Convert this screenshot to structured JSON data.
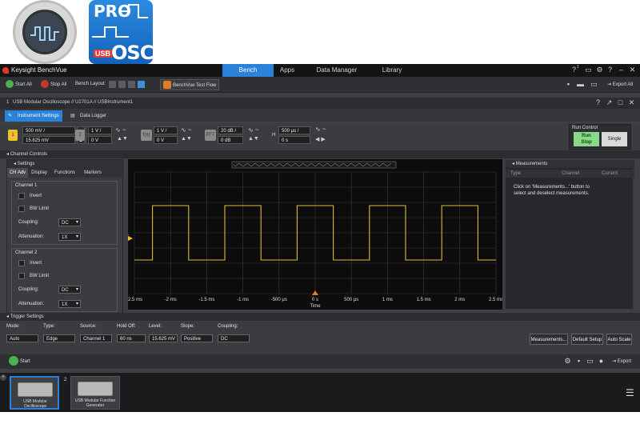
{
  "window": {
    "app_name": "Keysight BenchVue",
    "nav_tabs": [
      "Bench",
      "Apps",
      "Data Manager",
      "Library"
    ],
    "help_count": "1"
  },
  "logos": {
    "pro": "PRO",
    "usb": "USB",
    "osc": "OSC"
  },
  "toolbar": {
    "start_all": "Start All",
    "stop_all": "Stop All",
    "bench_layout": "Bench Layout:",
    "test_flow": "BenchVue Test Flow",
    "export_all": "Export All"
  },
  "instrument": {
    "index": "1",
    "path": "USB Modular Oscilloscope // U2701A // USBInstrument1",
    "tabs": [
      "Instrument Settings",
      "Data Logger"
    ]
  },
  "channels": [
    {
      "badge": "1",
      "scale": "500 mV /",
      "offset": "15.625 mV",
      "color": "#f2c02e"
    },
    {
      "badge": "2",
      "scale": "1 V /",
      "offset": "0 V",
      "color": "#8a8a8a"
    },
    {
      "badge": "f(x)",
      "scale": "1 V /",
      "offset": "0 V",
      "color": "#8a8a8a"
    },
    {
      "badge": "FFT",
      "scale": "20 dB /",
      "offset": "0 dB",
      "color": "#8a8a8a"
    }
  ],
  "horizontal": {
    "label": "H",
    "scale": "500 µs /",
    "position": "0 s"
  },
  "run_control": {
    "title": "Run Control",
    "run_stop": [
      "Run",
      "Stop"
    ],
    "single": "Single"
  },
  "channel_controls_label": "Channel Controls",
  "settings": {
    "title": "Settings",
    "tabs": [
      "CH Adv",
      "Display",
      "Functions",
      "Markers"
    ],
    "channel1": {
      "title": "Channel 1",
      "invert": "Invert",
      "bw_limit": "BW Limit",
      "coupling_label": "Coupling:",
      "coupling": "DC",
      "atten_label": "Attenuation:",
      "atten": "1X"
    },
    "channel2": {
      "title": "Channel 2",
      "invert": "Invert",
      "bw_limit": "BW Limit",
      "coupling_label": "Coupling:",
      "coupling": "DC",
      "atten_label": "Attenuation:",
      "atten": "1X"
    }
  },
  "scope": {
    "x_ticks": [
      "-2.5 ms",
      "-2 ms",
      "-1.5 ms",
      "-1 ms",
      "-500 µs",
      "0 s",
      "500 µs",
      "1 ms",
      "1.5 ms",
      "2 ms",
      "2.5 ms"
    ],
    "x_label": "Time",
    "trace_color": "#e0b83a",
    "channel_marker": "1"
  },
  "measurements": {
    "title": "Measurements",
    "columns": [
      "Type",
      "Channel",
      "Current"
    ],
    "hint": "Click on 'Measurements...' button to select and deselect measurements."
  },
  "trigger": {
    "title": "Trigger Settings",
    "fields": [
      {
        "label": "Mode:",
        "value": "Auto"
      },
      {
        "label": "Type:",
        "value": "Edge"
      },
      {
        "label": "Source:",
        "value": "Channel 1"
      },
      {
        "label": "Hold Off:",
        "value": "60 ns"
      },
      {
        "label": "Level:",
        "value": "15.625 mV"
      },
      {
        "label": "Slope:",
        "value": "Positive"
      },
      {
        "label": "Coupling:",
        "value": "DC"
      }
    ],
    "buttons": [
      "Measurements...",
      "Default Setup",
      "Auto Scale"
    ]
  },
  "bottom": {
    "start": "Start",
    "export": "Export"
  },
  "thumbnails": [
    {
      "index": "1",
      "label": "USB Modular Oscilloscope"
    },
    {
      "index": "2",
      "label": "USB Modular Function Generator"
    }
  ]
}
